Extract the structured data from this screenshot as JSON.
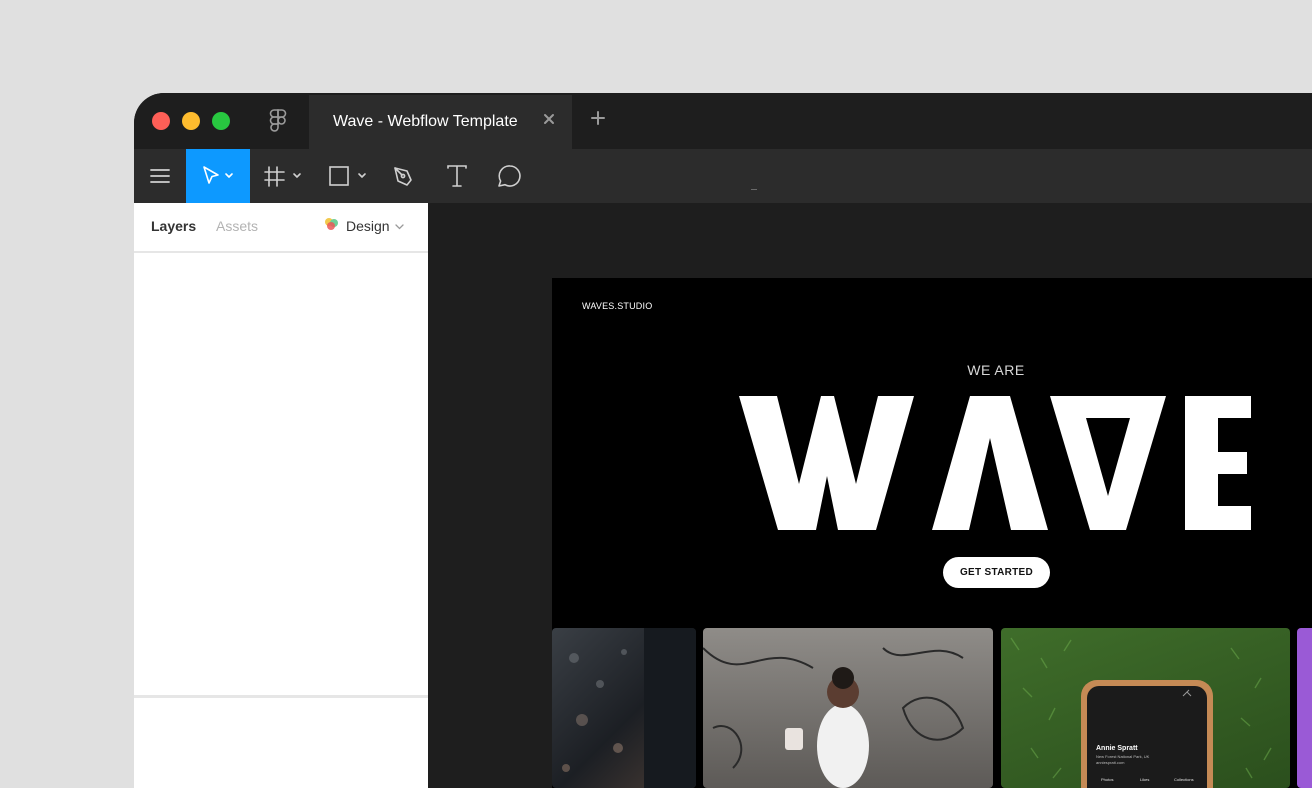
{
  "window": {
    "tab_title": "Wave - Webflow Template",
    "traffic_lights": {
      "close": "#fe5f57",
      "minimize": "#febc2e",
      "zoom": "#28c840"
    },
    "icons": [
      "figma-logo-icon",
      "close-tab-icon",
      "new-tab-icon"
    ]
  },
  "toolbar": {
    "accent": "#0d99ff",
    "tools": [
      "menu-icon",
      "move-tool-icon",
      "frame-tool-icon",
      "shape-tool-icon",
      "pen-tool-icon",
      "text-tool-icon",
      "comment-tool-icon"
    ]
  },
  "left_panel": {
    "tabs": [
      "Layers",
      "Assets"
    ],
    "active_tab": "Layers",
    "design_menu": "Design"
  },
  "artboard": {
    "logo": "WAVES.STUDIO",
    "kicker": "WE ARE",
    "hero_word": "WAVE",
    "cta": "GET STARTED",
    "phone_card": {
      "name": "Annie Spratt",
      "location": "New Forest National Park, UK",
      "website": "anniespratt.com",
      "tabs": [
        "Photos",
        "Likes",
        "Collections"
      ]
    }
  }
}
